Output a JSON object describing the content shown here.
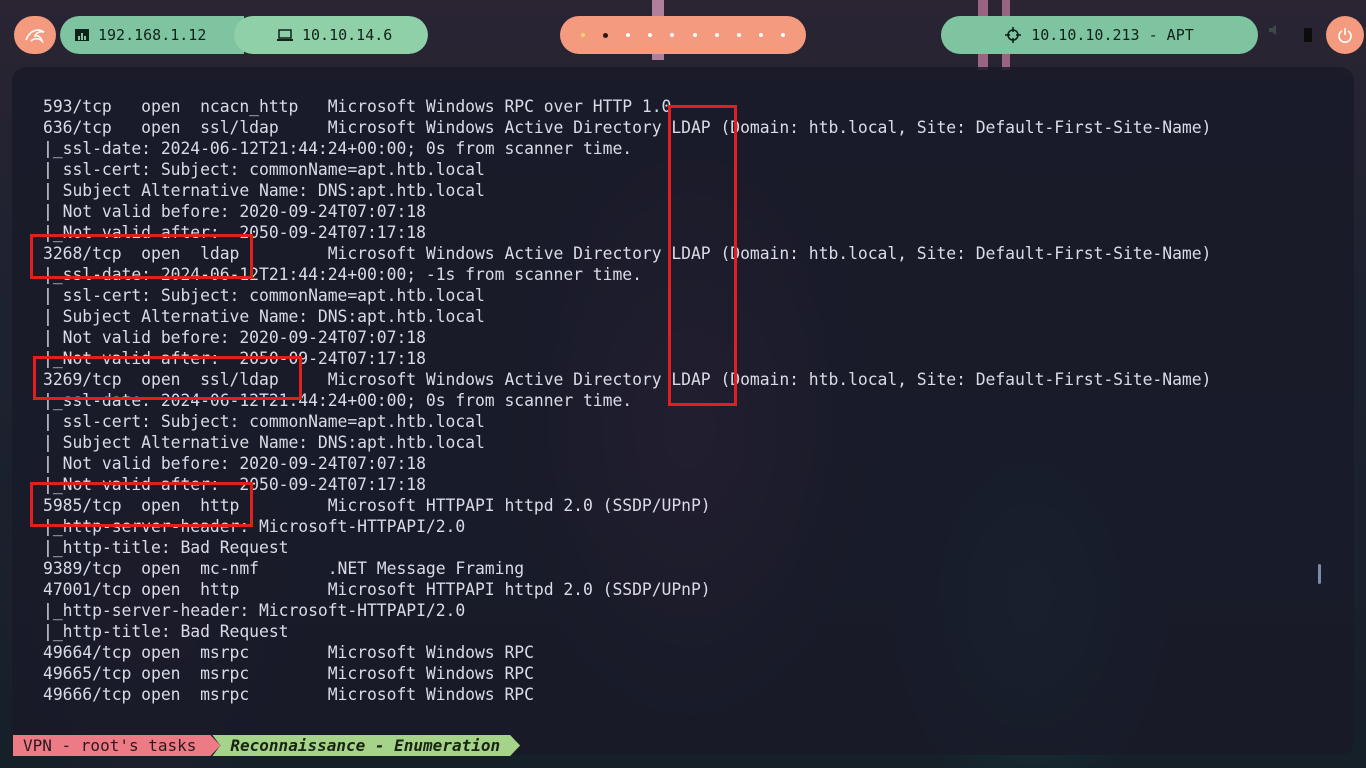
{
  "topbar": {
    "left_power_icon": "kali-dragon-icon",
    "local_ip": "192.168.1.12",
    "local_ip_icon": "network-icon",
    "vpn_ip": "10.10.14.6",
    "vpn_ip_icon": "laptop-icon",
    "workspace_count": 10,
    "active_workspace": 2,
    "target": "10.10.10.213 - APT",
    "target_icon": "crosshair-icon",
    "right_power_icon": "power-icon"
  },
  "terminal": {
    "lines": [
      "593/tcp   open  ncacn_http   Microsoft Windows RPC over HTTP 1.0",
      "636/tcp   open  ssl/ldap     Microsoft Windows Active Directory LDAP (Domain: htb.local, Site: Default-First-Site-Name)",
      "|_ssl-date: 2024-06-12T21:44:24+00:00; 0s from scanner time.",
      "| ssl-cert: Subject: commonName=apt.htb.local",
      "| Subject Alternative Name: DNS:apt.htb.local",
      "| Not valid before: 2020-09-24T07:07:18",
      "|_Not valid after:  2050-09-24T07:17:18",
      "3268/tcp  open  ldap         Microsoft Windows Active Directory LDAP (Domain: htb.local, Site: Default-First-Site-Name)",
      "|_ssl-date: 2024-06-12T21:44:24+00:00; -1s from scanner time.",
      "| ssl-cert: Subject: commonName=apt.htb.local",
      "| Subject Alternative Name: DNS:apt.htb.local",
      "| Not valid before: 2020-09-24T07:07:18",
      "|_Not valid after:  2050-09-24T07:17:18",
      "3269/tcp  open  ssl/ldap     Microsoft Windows Active Directory LDAP (Domain: htb.local, Site: Default-First-Site-Name)",
      "|_ssl-date: 2024-06-12T21:44:24+00:00; 0s from scanner time.",
      "| ssl-cert: Subject: commonName=apt.htb.local",
      "| Subject Alternative Name: DNS:apt.htb.local",
      "| Not valid before: 2020-09-24T07:07:18",
      "|_Not valid after:  2050-09-24T07:17:18",
      "5985/tcp  open  http         Microsoft HTTPAPI httpd 2.0 (SSDP/UPnP)",
      "|_http-server-header: Microsoft-HTTPAPI/2.0",
      "|_http-title: Bad Request",
      "9389/tcp  open  mc-nmf       .NET Message Framing",
      "47001/tcp open  http         Microsoft HTTPAPI httpd 2.0 (SSDP/UPnP)",
      "|_http-server-header: Microsoft-HTTPAPI/2.0",
      "|_http-title: Bad Request",
      "49664/tcp open  msrpc        Microsoft Windows RPC",
      "49665/tcp open  msrpc        Microsoft Windows RPC",
      "49666/tcp open  msrpc        Microsoft Windows RPC"
    ]
  },
  "annotations": {
    "color": "#e21f1f"
  },
  "status_bar": {
    "session": "VPN - root's tasks",
    "window": "Reconnaissance - Enumeration",
    "session_color": "#ec7b85",
    "window_color": "#a6d38a"
  }
}
